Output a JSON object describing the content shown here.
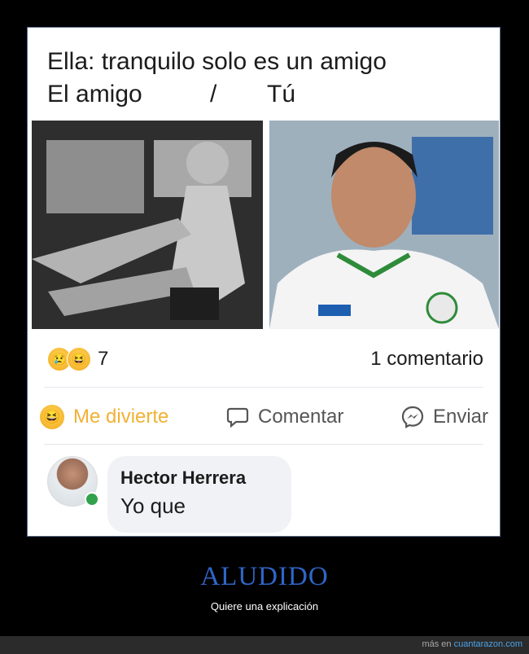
{
  "post": {
    "line1": "Ella: tranquilo solo es un amigo",
    "line2_left": "El amigo",
    "line2_slash": "/",
    "line2_right": "Tú"
  },
  "reactions": {
    "emoji_icons": [
      "sad-face-icon",
      "laughing-face-icon"
    ],
    "count": "7",
    "comments": "1 comentario"
  },
  "actions": {
    "react_label": "Me divierte",
    "comment_label": "Comentar",
    "send_label": "Enviar"
  },
  "comment": {
    "author": "Hector Herrera",
    "text": "Yo que"
  },
  "caption": {
    "title": "ALUDIDO",
    "subtitle": "Quiere una explicación"
  },
  "footer": {
    "prefix": "más en ",
    "site": "cuantarazon.com"
  },
  "colors": {
    "accent_link": "#2f66c8",
    "react_active": "#f2b134",
    "online": "#31a24c"
  }
}
